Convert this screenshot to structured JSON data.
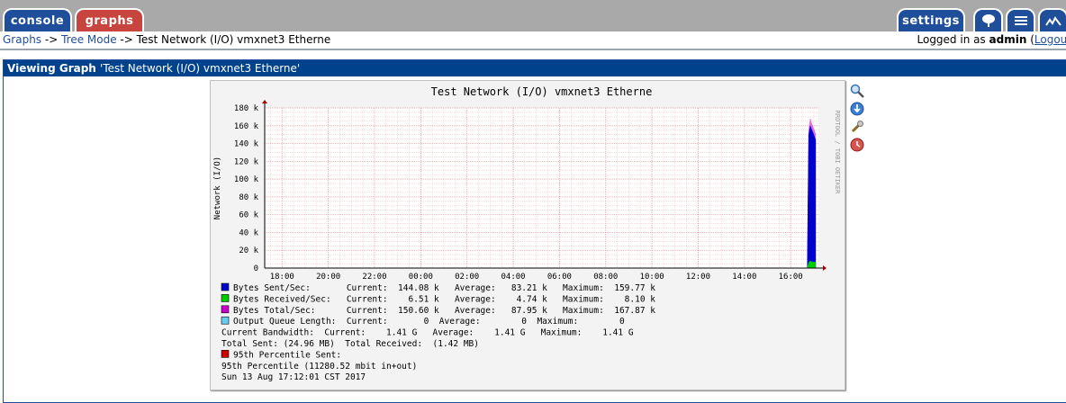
{
  "tabs": {
    "console": "console",
    "graphs": "graphs",
    "settings": "settings"
  },
  "nav": {
    "crumb_graphs": "Graphs",
    "sep1": " -> ",
    "crumb_tree": "Tree Mode",
    "sep2": " -> ",
    "crumb_current": "Test Network (I/O) vmxnet3 Etherne",
    "login_prefix": "Logged in as ",
    "user": "admin",
    "logout_open": " (",
    "logout": "Logout"
  },
  "panel": {
    "heading": "Viewing Graph",
    "graph_title_quoted": "'Test Network (I/O) vmxnet3 Etherne'"
  },
  "graph": {
    "title": "Test Network (I/O) vmxnet3 Etherne",
    "watermark": "RRDTOOL / TOBI OETIKER",
    "legend": [
      {
        "color": "#0000cc",
        "text": "Bytes Sent/Sec:       Current:  144.08 k   Average:   83.21 k   Maximum:  159.77 k"
      },
      {
        "color": "#00cc00",
        "text": "Bytes Received/Sec:   Current:    6.51 k   Average:    4.74 k   Maximum:    8.10 k"
      },
      {
        "color": "#cc00cc",
        "text": "Bytes Total/Sec:      Current:  150.60 k   Average:   87.95 k   Maximum:  167.87 k"
      },
      {
        "color": "#66ccee",
        "text": "Output Queue Length:  Current:       0  Average:        0  Maximum:        0"
      }
    ],
    "lines": [
      "Current Bandwidth:  Current:    1.41 G   Average:    1.41 G   Maximum:    1.41 G",
      "Total Sent: (24.96 MB)  Total Received:  (1.42 MB)"
    ],
    "percentile_color": "#cc0000",
    "percentile_label": "95th Percentile Sent:",
    "percentile_value": "95th Percentile (11280.52 mbit in+out)",
    "timestamp": "Sun 13 Aug 17:12:01 CST 2017"
  },
  "chart_data": {
    "type": "area",
    "title": "Test Network (I/O) vmxnet3 Etherne",
    "ylabel": "Network (I/O)",
    "xlabel": "",
    "y_ticks": [
      "0",
      "20 k",
      "40 k",
      "60 k",
      "80 k",
      "100 k",
      "120 k",
      "140 k",
      "160 k",
      "180 k"
    ],
    "ylim": [
      0,
      180000
    ],
    "x_ticks": [
      "18:00",
      "20:00",
      "22:00",
      "00:00",
      "02:00",
      "04:00",
      "06:00",
      "08:00",
      "10:00",
      "12:00",
      "14:00",
      "16:00"
    ],
    "x_range_hours": [
      17.25,
      41.2
    ],
    "grid": true,
    "series": [
      {
        "name": "Bytes Sent/Sec",
        "color": "#0000cc",
        "x": [
          40.72,
          40.78,
          40.85,
          40.92,
          41.0,
          41.08
        ],
        "values": [
          0,
          150000,
          159770,
          155000,
          150000,
          144080
        ]
      },
      {
        "name": "Bytes Received/Sec",
        "color": "#00cc00",
        "x": [
          40.72,
          40.78,
          40.85,
          40.92,
          41.0,
          41.08
        ],
        "values": [
          0,
          6000,
          8100,
          7000,
          6800,
          6510
        ]
      },
      {
        "name": "Bytes Total/Sec",
        "color": "#cc00cc",
        "x": [
          40.72,
          40.78,
          40.85,
          40.92,
          41.0,
          41.08
        ],
        "values": [
          0,
          156000,
          167870,
          162000,
          156800,
          150600
        ]
      }
    ]
  }
}
